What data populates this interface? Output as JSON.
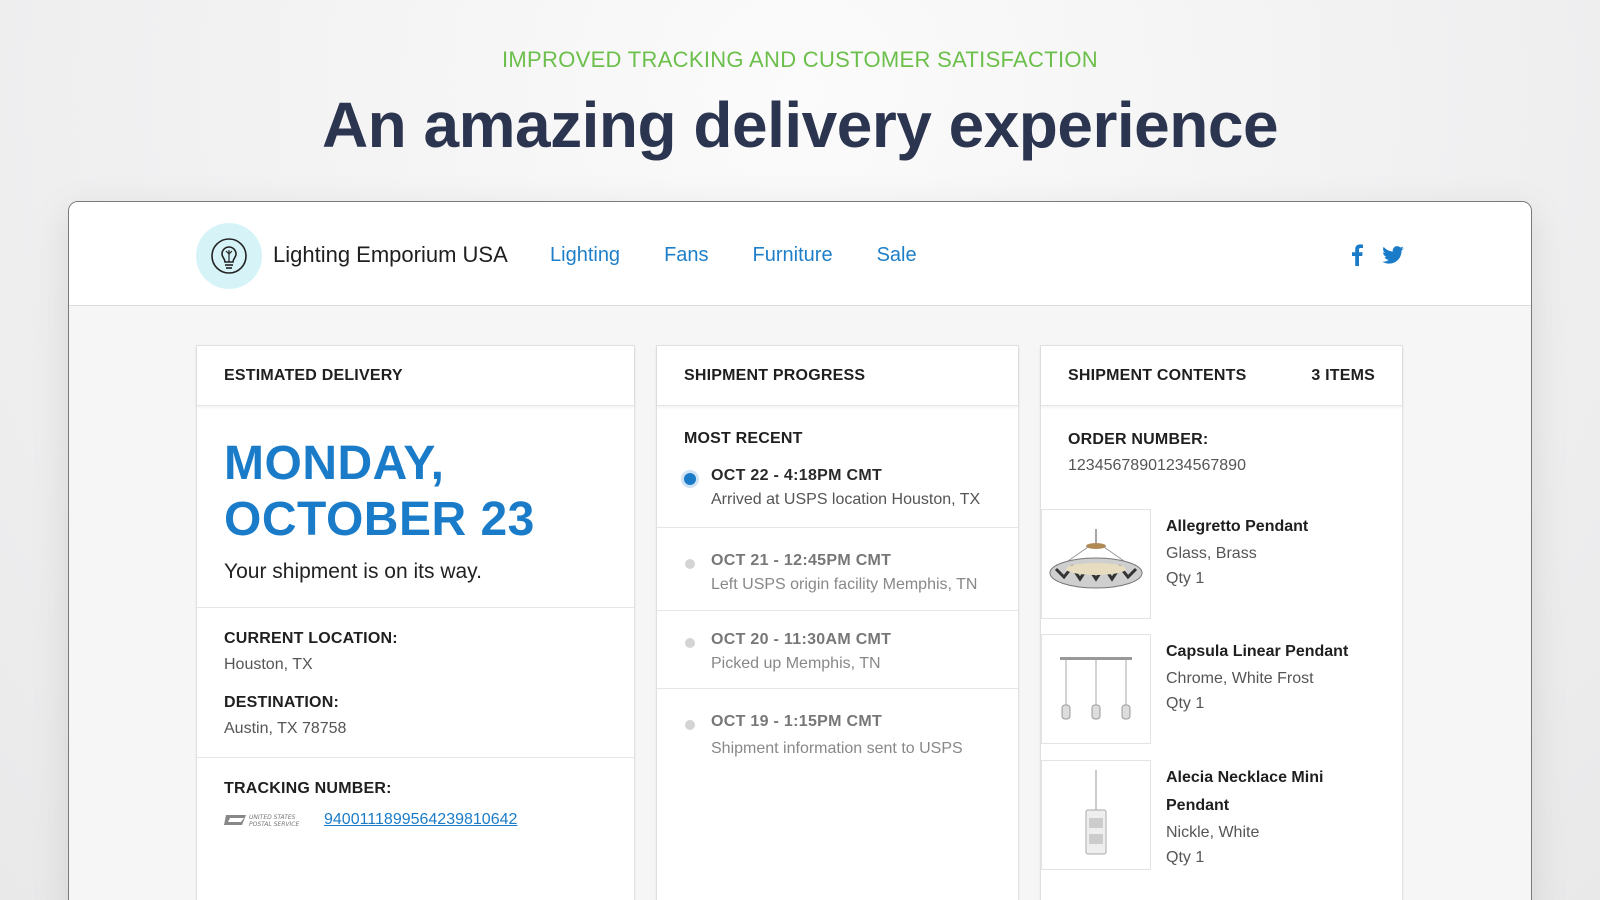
{
  "hero": {
    "eyebrow": "IMPROVED TRACKING AND CUSTOMER SATISFACTION",
    "headline": "An amazing delivery experience"
  },
  "store": {
    "brand": "Lighting Emporium USA",
    "nav": [
      "Lighting",
      "Fans",
      "Furniture",
      "Sale"
    ],
    "social_icons": [
      "facebook-icon",
      "twitter-icon"
    ],
    "accent": "#1a7cc9"
  },
  "estimated_delivery": {
    "header": "ESTIMATED DELIVERY",
    "day": "MONDAY,",
    "date": "OCTOBER 23",
    "message": "Your shipment is on its way.",
    "current_location_label": "CURRENT LOCATION:",
    "current_location": "Houston, TX",
    "destination_label": "DESTINATION:",
    "destination": "Austin, TX 78758",
    "tracking_label": "TRACKING NUMBER:",
    "tracking_number": "9400111899564239810642",
    "carrier_icon": "usps-logo"
  },
  "progress": {
    "header": "SHIPMENT PROGRESS",
    "most_recent_label": "MOST RECENT",
    "events": [
      {
        "time": "OCT 22 - 4:18PM CMT",
        "desc": "Arrived at USPS location Houston, TX"
      },
      {
        "time": "OCT 21 - 12:45PM CMT",
        "desc": "Left USPS origin facility Memphis, TN"
      },
      {
        "time": "OCT 20 - 11:30AM CMT",
        "desc": "Picked up Memphis, TN"
      },
      {
        "time": "OCT 19 - 1:15PM CMT",
        "desc": "Shipment information sent to USPS"
      }
    ]
  },
  "contents": {
    "header": "SHIPMENT CONTENTS",
    "count": "3 ITEMS",
    "order_label": "ORDER NUMBER:",
    "order_number": "12345678901234567890",
    "items": [
      {
        "name": "Allegretto Pendant",
        "material": "Glass, Brass",
        "qty": "Qty 1"
      },
      {
        "name": "Capsula Linear Pendant",
        "material": "Chrome, White Frost",
        "qty": "Qty 1"
      },
      {
        "name": "Alecia Necklace Mini Pendant",
        "material": "Nickle, White",
        "qty": "Qty 1"
      }
    ]
  }
}
